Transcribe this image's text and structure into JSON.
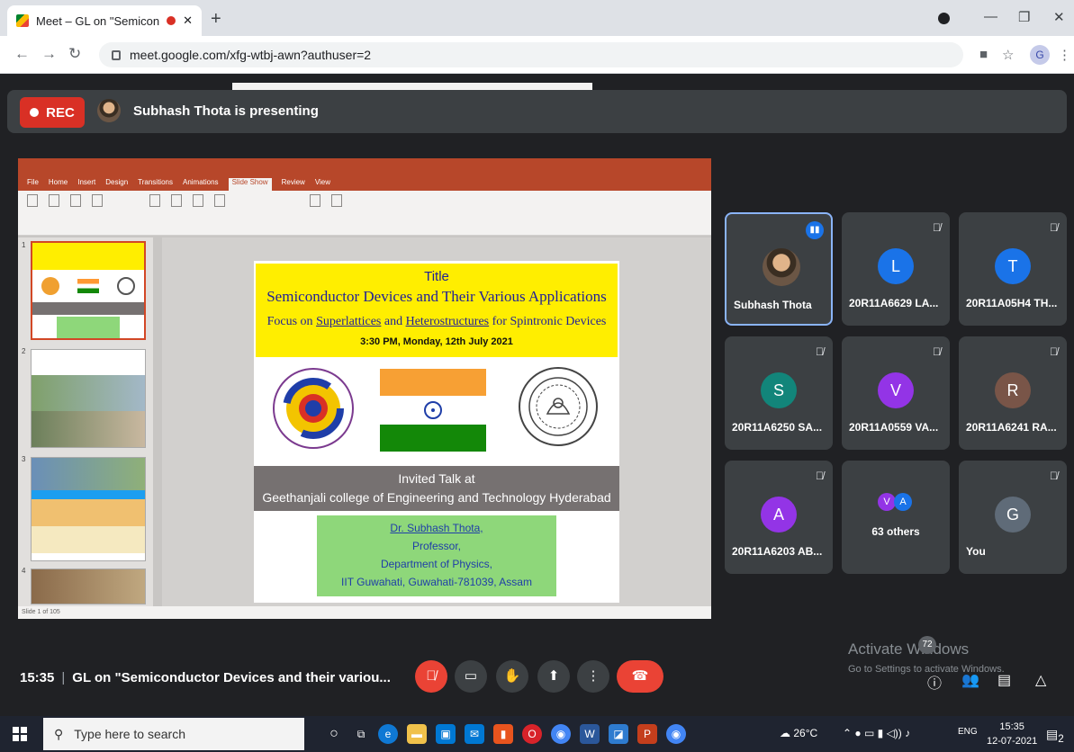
{
  "browser": {
    "tab_title": "Meet – GL on \"Semiconduct",
    "tab_close": "✕",
    "new_tab": "+",
    "url": "meet.google.com/xfg-wtbj-awn?authuser=2",
    "profile_initial": "G"
  },
  "banner": {
    "rec_label": "REC",
    "presenting_text": "Subhash Thota is presenting"
  },
  "slide": {
    "title_label": "Title",
    "title": "Semiconductor Devices and Their Various Applications",
    "focus_prefix": "Focus on ",
    "focus_term1": "Superlattices",
    "focus_mid": " and ",
    "focus_term2": "Heterostructures",
    "focus_suffix": " for Spintronic Devices",
    "date_line": "3:30 PM, Monday, 12th July 2021",
    "invited": "Invited Talk at",
    "venue": "Geethanjali college of Engineering and Technology Hyderabad",
    "speaker": "Dr. Subhash Thota,",
    "role": "Professor,",
    "dept": "Department of Physics,",
    "institute": "IIT Guwahati, Guwahati-781039, Assam"
  },
  "powerpoint": {
    "tabs": [
      "File",
      "Home",
      "Insert",
      "Design",
      "Transitions",
      "Animations",
      "Slide Show",
      "Review",
      "View"
    ],
    "active_tab": "Slide Show",
    "status": "Slide 1 of 105"
  },
  "participants": [
    {
      "name": "Subhash Thota",
      "initial": "",
      "color": "",
      "speaking": true
    },
    {
      "name": "20R11A6629 LA...",
      "initial": "L",
      "color": "#1a73e8"
    },
    {
      "name": "20R11A05H4 TH...",
      "initial": "T",
      "color": "#1a73e8"
    },
    {
      "name": "20R11A6250 SA...",
      "initial": "S",
      "color": "#12857a"
    },
    {
      "name": "20R11A0559 VA...",
      "initial": "V",
      "color": "#9334e6"
    },
    {
      "name": "20R11A6241 RA...",
      "initial": "R",
      "color": "#795548"
    },
    {
      "name": "20R11A6203 AB...",
      "initial": "A",
      "color": "#9334e6"
    },
    {
      "name": "63 others",
      "initial": "",
      "color": ""
    },
    {
      "name": "You",
      "initial": "G",
      "color": "#5f6b78"
    }
  ],
  "others_avatars": [
    "V",
    "A"
  ],
  "meetbar": {
    "time": "15:35",
    "meeting_title": "GL on \"Semiconductor Devices and their variou...",
    "participant_count": "72"
  },
  "watermark": {
    "line1": "Activate Windows",
    "line2": "Go to Settings to activate Windows."
  },
  "taskbar": {
    "search_placeholder": "Type here to search",
    "weather": "26°C",
    "lang": "ENG",
    "time": "15:35",
    "date": "12-07-2021",
    "notif_count": "2"
  },
  "colors": {
    "meet_bg": "#202124",
    "tile_bg": "#3c4043",
    "rec_red": "#d93025",
    "slide_yellow": "#ffee00",
    "slide_green": "#8ed77a"
  }
}
